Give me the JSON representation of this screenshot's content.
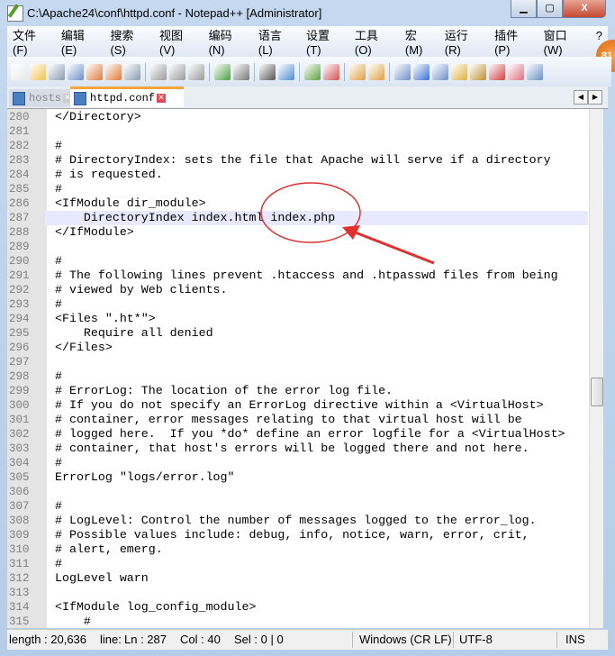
{
  "window": {
    "title": "C:\\Apache24\\conf\\httpd.conf - Notepad++ [Administrator]",
    "minimize": "▁",
    "maximize": "▢",
    "close": "X"
  },
  "menu": [
    "文件(F)",
    "编辑(E)",
    "搜索(S)",
    "视图(V)",
    "编码(N)",
    "语言(L)",
    "设置(T)",
    "工具(O)",
    "宏(M)",
    "运行(R)",
    "插件(P)",
    "窗口(W)",
    "?"
  ],
  "badge": "81",
  "toolbar_icons": [
    "new-file-icon",
    "open-file-icon",
    "save-icon",
    "save-all-icon",
    "close-icon",
    "close-all-icon",
    "print-icon",
    "sep",
    "cut-icon",
    "copy-icon",
    "paste-icon",
    "sep",
    "undo-icon",
    "redo-icon",
    "sep",
    "find-icon",
    "replace-icon",
    "sep",
    "zoom-in-icon",
    "zoom-out-icon",
    "sep",
    "sync-v-icon",
    "sync-h-icon",
    "sep",
    "wrap-icon",
    "show-all-chars-icon",
    "indent-guide-icon",
    "doc-map-icon",
    "function-list-icon",
    "macro-record-icon",
    "folder-icon",
    "eye-icon"
  ],
  "tabs": [
    {
      "label": "hosts",
      "active": false
    },
    {
      "label": "httpd.conf",
      "active": true
    }
  ],
  "editor": {
    "current_line": 287,
    "lines": [
      [
        "280",
        "</Directory>"
      ],
      [
        "281",
        ""
      ],
      [
        "282",
        "#"
      ],
      [
        "283",
        "# DirectoryIndex: sets the file that Apache will serve if a directory"
      ],
      [
        "284",
        "# is requested."
      ],
      [
        "285",
        "#"
      ],
      [
        "286",
        "<IfModule dir_module>"
      ],
      [
        "287",
        "    DirectoryIndex index.html index.php"
      ],
      [
        "288",
        "</IfModule>"
      ],
      [
        "289",
        ""
      ],
      [
        "290",
        "#"
      ],
      [
        "291",
        "# The following lines prevent .htaccess and .htpasswd files from being"
      ],
      [
        "292",
        "# viewed by Web clients."
      ],
      [
        "293",
        "#"
      ],
      [
        "294",
        "<Files \".ht*\">"
      ],
      [
        "295",
        "    Require all denied"
      ],
      [
        "296",
        "</Files>"
      ],
      [
        "297",
        ""
      ],
      [
        "298",
        "#"
      ],
      [
        "299",
        "# ErrorLog: The location of the error log file."
      ],
      [
        "300",
        "# If you do not specify an ErrorLog directive within a <VirtualHost>"
      ],
      [
        "301",
        "# container, error messages relating to that virtual host will be"
      ],
      [
        "302",
        "# logged here.  If you *do* define an error logfile for a <VirtualHost>"
      ],
      [
        "303",
        "# container, that host's errors will be logged there and not here."
      ],
      [
        "304",
        "#"
      ],
      [
        "305",
        "ErrorLog \"logs/error.log\""
      ],
      [
        "306",
        ""
      ],
      [
        "307",
        "#"
      ],
      [
        "308",
        "# LogLevel: Control the number of messages logged to the error_log."
      ],
      [
        "309",
        "# Possible values include: debug, info, notice, warn, error, crit,"
      ],
      [
        "310",
        "# alert, emerg."
      ],
      [
        "311",
        "#"
      ],
      [
        "312",
        "LogLevel warn"
      ],
      [
        "313",
        ""
      ],
      [
        "314",
        "<IfModule log_config_module>"
      ],
      [
        "315",
        "    #"
      ]
    ]
  },
  "status": {
    "length": "length : 20,636",
    "lines": "line:",
    "ln": "Ln : 287",
    "col": "Col : 40",
    "sel": "Sel : 0 | 0",
    "eol": "Windows (CR LF)",
    "encoding": "UTF-8",
    "mode": "INS"
  },
  "colors": {
    "annotation": "#e03030",
    "current_line": "#e8e8ff",
    "tab_accent": "#f5a53c"
  }
}
